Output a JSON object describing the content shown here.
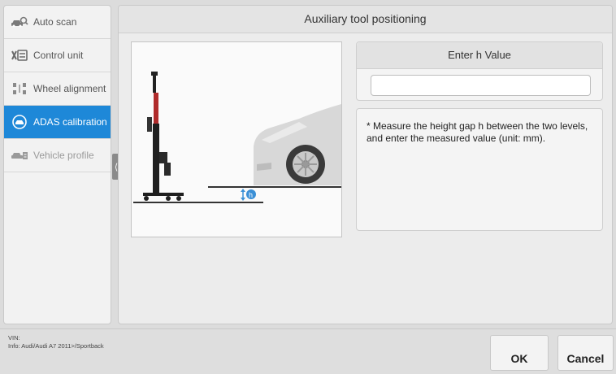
{
  "sidebar": {
    "items": [
      {
        "label": "Auto scan",
        "icon": "car-search-icon"
      },
      {
        "label": "Control unit",
        "icon": "control-unit-icon"
      },
      {
        "label": "Wheel alignment",
        "icon": "wheel-alignment-icon"
      },
      {
        "label": "ADAS calibration",
        "icon": "adas-icon",
        "active": true
      },
      {
        "label": "Vehicle profile",
        "icon": "vehicle-profile-icon"
      }
    ],
    "collapse_glyph": "⟨"
  },
  "main": {
    "title": "Auxiliary tool positioning",
    "illustration": {
      "height_marker": "h"
    },
    "input_card": {
      "header": "Enter h Value",
      "value": "",
      "placeholder": ""
    },
    "note": "* Measure the height gap h between the two levels, and enter the measured value (unit: mm)."
  },
  "footer": {
    "vin_line": "VIN:",
    "info_line": "Info: Audi/Audi A7 2011>/Sportback",
    "ok_label": "OK",
    "cancel_label": "Cancel"
  },
  "colors": {
    "accent": "#1e88d8",
    "height_marker": "#3a8fd6"
  }
}
